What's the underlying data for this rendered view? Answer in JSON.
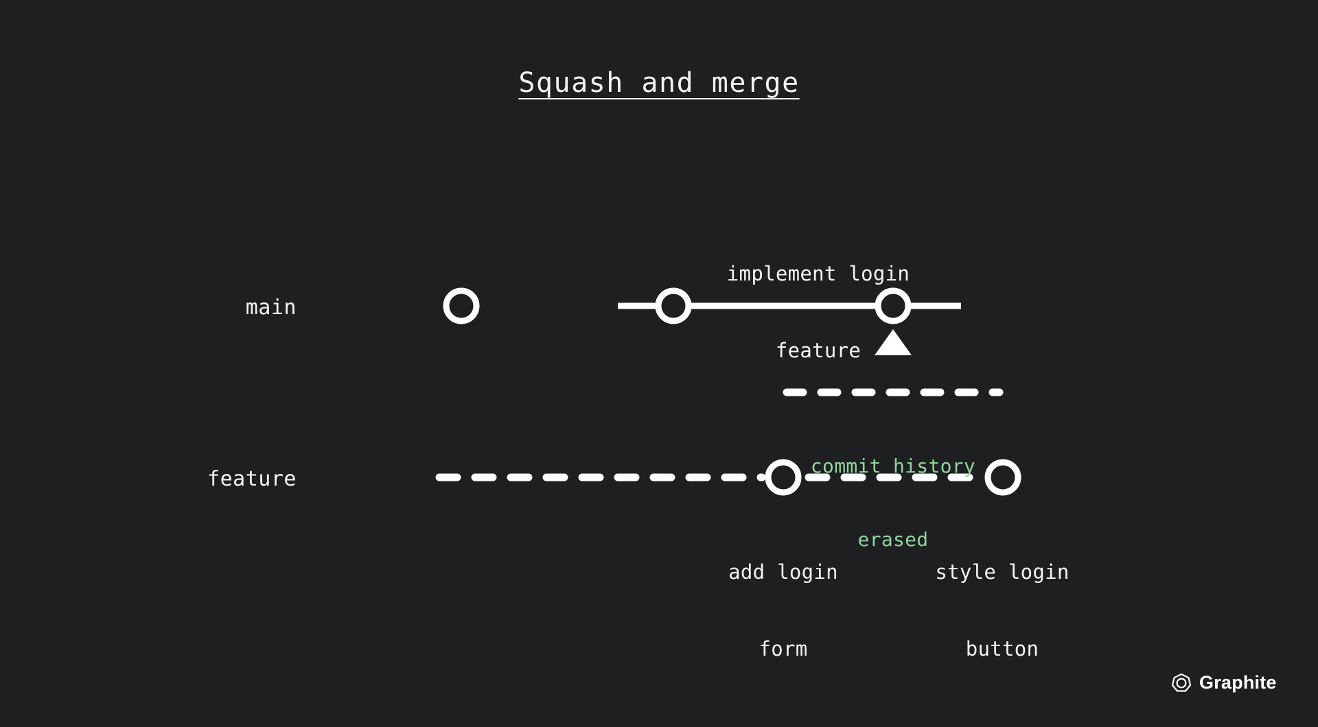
{
  "background_color": "#1e1f21",
  "title": "Squash and merge",
  "branches": [
    {
      "name": "main",
      "label": "main",
      "style": "solid",
      "color": "#ffffff"
    },
    {
      "name": "feature",
      "label": "feature",
      "style": "dashed",
      "color": "#ffffff"
    }
  ],
  "main_commits": [
    {
      "label": ""
    },
    {
      "label": ""
    },
    {
      "label": "implement login\nfeature"
    }
  ],
  "feature_commits": [
    {
      "label": "add login\nform"
    },
    {
      "label": "style login\nbutton"
    }
  ],
  "labels": {
    "merge_commit_line1": "implement login",
    "merge_commit_line2": "feature",
    "feature_commit_1_line1": "add login",
    "feature_commit_1_line2": "form",
    "feature_commit_2_line1": "style login",
    "feature_commit_2_line2": "button"
  },
  "annotation": {
    "line1": "commit history",
    "line2": "erased",
    "color": "#90d59d",
    "box_style": "dashed"
  },
  "arrow": {
    "direction": "up",
    "style": "dashed",
    "color": "#ffffff"
  },
  "brand": {
    "name": "Graphite",
    "logo_icon": "graphite-hexagon-logo"
  }
}
